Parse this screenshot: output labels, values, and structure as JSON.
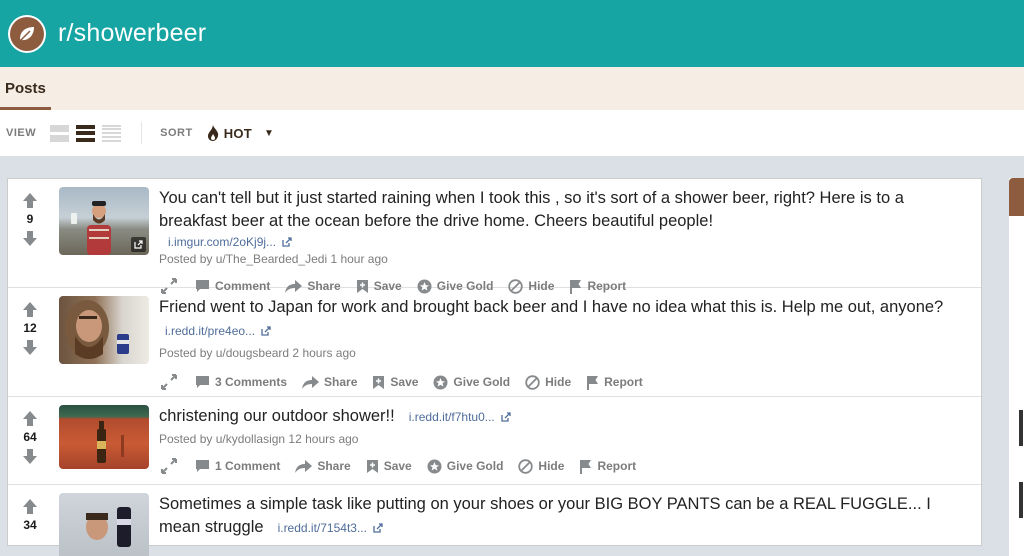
{
  "header": {
    "subreddit": "r/showerbeer",
    "brand_color": "#17a5a4",
    "icon": "beer-leaf-icon"
  },
  "tabs": {
    "posts": "Posts"
  },
  "toolbar": {
    "view_label": "VIEW",
    "sort_label": "SORT",
    "sort_value": "HOT"
  },
  "posts": [
    {
      "score": "9",
      "title": "You can't tell but it just started raining when I took this , so it's sort of a shower beer, right? Here is to a breakfast beer at the ocean before the drive home. Cheers beautiful people!",
      "domain": "i.imgur.com/2oKj9j...",
      "meta": "Posted by u/The_Bearded_Jedi 1 hour ago",
      "comments": "Comment",
      "share": "Share",
      "save": "Save",
      "gold": "Give Gold",
      "hide": "Hide",
      "report": "Report"
    },
    {
      "score": "12",
      "title": "Friend went to Japan for work and brought back beer and I have no idea what this is. Help me out, anyone?",
      "domain": "i.redd.it/pre4eo...",
      "meta": "Posted by u/dougsbeard 2 hours ago",
      "comments": "3 Comments",
      "share": "Share",
      "save": "Save",
      "gold": "Give Gold",
      "hide": "Hide",
      "report": "Report"
    },
    {
      "score": "64",
      "title": "christening our outdoor shower!!",
      "domain": "i.redd.it/f7htu0...",
      "meta": "Posted by u/kydollasign 12 hours ago",
      "comments": "1 Comment",
      "share": "Share",
      "save": "Save",
      "gold": "Give Gold",
      "hide": "Hide",
      "report": "Report"
    },
    {
      "score": "34",
      "title": "Sometimes a simple task like putting on your shoes or your BIG BOY PANTS can be a REAL FUGGLE... I mean struggle",
      "domain": "i.redd.it/7154t3...",
      "meta": "",
      "comments": "",
      "share": "",
      "save": "",
      "gold": "",
      "hide": "",
      "report": ""
    }
  ]
}
